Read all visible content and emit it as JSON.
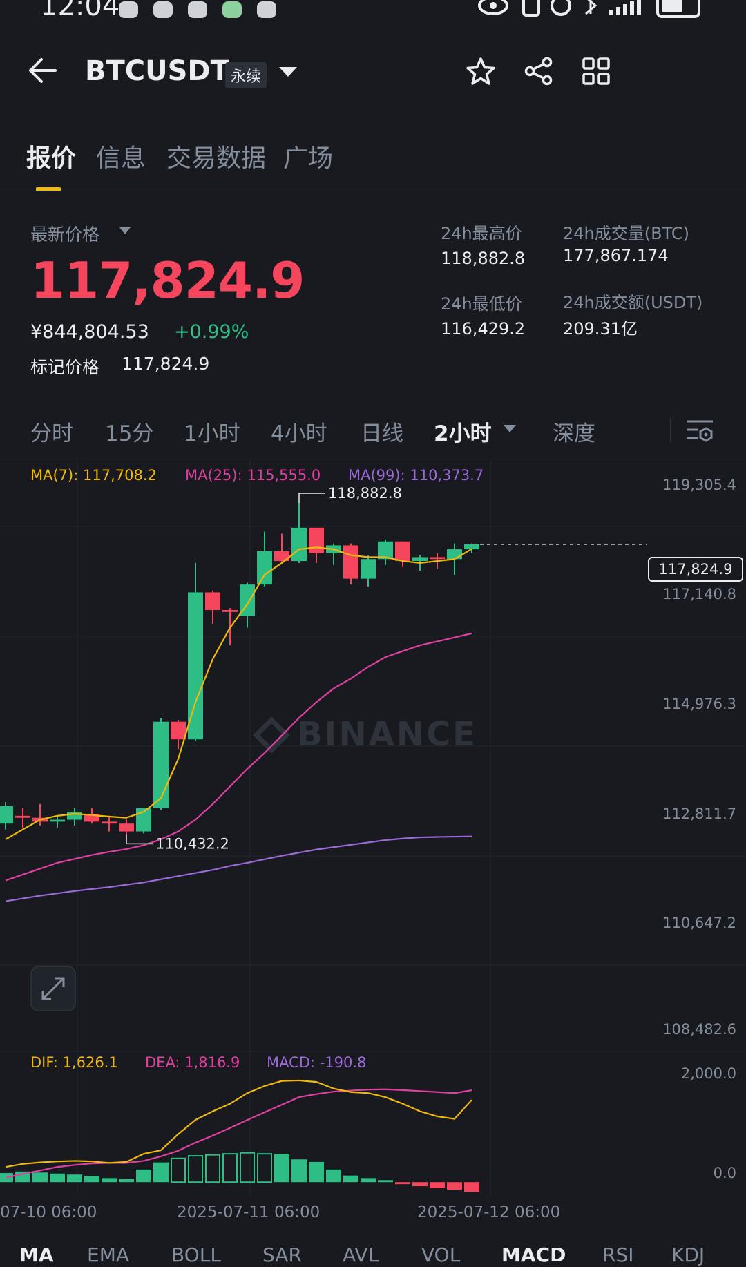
{
  "status_bar": {
    "time": "12:04"
  },
  "header": {
    "symbol": "BTCUSDT",
    "contract_type": "永续"
  },
  "tabs": [
    "报价",
    "信息",
    "交易数据",
    "广场"
  ],
  "price": {
    "label": "最新价格",
    "last": "117,824.9",
    "cny": "¥844,804.53",
    "change": "+0.99%",
    "mark_label": "标记价格",
    "mark": "117,824.9"
  },
  "stats": {
    "high_label": "24h最高价",
    "high": "118,882.8",
    "low_label": "24h最低价",
    "low": "116,429.2",
    "vol_label": "24h成交量(BTC)",
    "vol": "177,867.174",
    "amount_label": "24h成交额(USDT)",
    "amount": "209.31亿"
  },
  "timeframes": [
    "分时",
    "15分",
    "1小时",
    "4小时",
    "日线",
    "2小时",
    "深度"
  ],
  "ma_legend": {
    "ma7": "MA(7): 117,708.2",
    "ma25": "MA(25): 115,555.0",
    "ma99": "MA(99): 110,373.7"
  },
  "price_axis": [
    "119,305.4",
    "117,140.8",
    "114,976.3",
    "112,811.7",
    "110,647.2",
    "108,482.6"
  ],
  "current_price_tag": "117,824.9",
  "watermark": "BINANCE",
  "annotations": {
    "high": "118,882.8",
    "low": "110,432.2"
  },
  "macd_legend": {
    "dif": "DIF: 1,626.1",
    "dea": "DEA: 1,816.9",
    "macd": "MACD: -190.8"
  },
  "macd_axis": [
    "2,000.0",
    "0.0"
  ],
  "x_axis": [
    "07-10 06:00",
    "2025-07-11 06:00",
    "2025-07-12 06:00"
  ],
  "indicator_tabs": [
    "MA",
    "EMA",
    "BOLL",
    "SAR",
    "AVL",
    "VOL",
    "MACD",
    "RSI",
    "KDJ"
  ],
  "colors": {
    "up": "#2ebd85",
    "down": "#f6465d",
    "accent": "#f0b90b",
    "ma7": "#f0b90b",
    "ma25": "#e040a0",
    "ma99": "#9c6ad8"
  },
  "chart_data": {
    "type": "candlestick",
    "interval": "2小时",
    "ylim": [
      108482.6,
      119305.4
    ],
    "candles": [
      {
        "o": 110700,
        "h": 111250,
        "l": 110550,
        "c": 111150
      },
      {
        "o": 110900,
        "h": 111100,
        "l": 110600,
        "c": 110850
      },
      {
        "o": 110850,
        "h": 111200,
        "l": 110650,
        "c": 110750
      },
      {
        "o": 110750,
        "h": 110900,
        "l": 110600,
        "c": 110800
      },
      {
        "o": 110800,
        "h": 111100,
        "l": 110650,
        "c": 111000
      },
      {
        "o": 110950,
        "h": 111100,
        "l": 110700,
        "c": 110750
      },
      {
        "o": 110750,
        "h": 110900,
        "l": 110500,
        "c": 110700
      },
      {
        "o": 110700,
        "h": 110800,
        "l": 110432.2,
        "c": 110500
      },
      {
        "o": 110500,
        "h": 111100,
        "l": 110450,
        "c": 111100
      },
      {
        "o": 111100,
        "h": 113400,
        "l": 111050,
        "c": 113300
      },
      {
        "o": 113300,
        "h": 113350,
        "l": 112600,
        "c": 112850
      },
      {
        "o": 112850,
        "h": 117350,
        "l": 112800,
        "c": 116600
      },
      {
        "o": 116600,
        "h": 116650,
        "l": 115800,
        "c": 116150
      },
      {
        "o": 116150,
        "h": 116200,
        "l": 115250,
        "c": 116100
      },
      {
        "o": 116000,
        "h": 116850,
        "l": 115700,
        "c": 116800
      },
      {
        "o": 116800,
        "h": 118150,
        "l": 116750,
        "c": 117650
      },
      {
        "o": 117650,
        "h": 118100,
        "l": 117350,
        "c": 117400
      },
      {
        "o": 117400,
        "h": 118882.8,
        "l": 117350,
        "c": 118250
      },
      {
        "o": 118250,
        "h": 118250,
        "l": 117350,
        "c": 117600
      },
      {
        "o": 117600,
        "h": 117850,
        "l": 117300,
        "c": 117800
      },
      {
        "o": 117800,
        "h": 117850,
        "l": 116800,
        "c": 116950
      },
      {
        "o": 116950,
        "h": 117550,
        "l": 116750,
        "c": 117450
      },
      {
        "o": 117450,
        "h": 117950,
        "l": 117300,
        "c": 117900
      },
      {
        "o": 117900,
        "h": 117900,
        "l": 117250,
        "c": 117400
      },
      {
        "o": 117400,
        "h": 117550,
        "l": 117150,
        "c": 117500
      },
      {
        "o": 117500,
        "h": 117600,
        "l": 117200,
        "c": 117450
      },
      {
        "o": 117450,
        "h": 117850,
        "l": 117050,
        "c": 117700
      },
      {
        "o": 117700,
        "h": 117850,
        "l": 117600,
        "c": 117824.9
      }
    ],
    "ma7": [
      110300,
      110550,
      110800,
      110900,
      110950,
      110920,
      110880,
      110850,
      111000,
      111350,
      112350,
      113800,
      114900,
      115700,
      116300,
      117050,
      117350,
      117700,
      117750,
      117700,
      117550,
      117500,
      117500,
      117400,
      117350,
      117400,
      117450,
      117708.2
    ],
    "ma25": [
      109250,
      109400,
      109550,
      109700,
      109800,
      109900,
      109980,
      110050,
      110150,
      110300,
      110500,
      110800,
      111200,
      111650,
      112100,
      112500,
      112950,
      113400,
      113800,
      114150,
      114400,
      114700,
      114950,
      115100,
      115250,
      115350,
      115450,
      115555.0
    ],
    "ma99": [
      108720,
      108790,
      108860,
      108920,
      108980,
      109030,
      109080,
      109140,
      109200,
      109280,
      109360,
      109440,
      109520,
      109620,
      109700,
      109790,
      109880,
      109960,
      110040,
      110100,
      110160,
      110220,
      110280,
      110320,
      110350,
      110360,
      110368,
      110373.7
    ],
    "macd": {
      "ylim": [
        -120,
        2200
      ],
      "dif": [
        300,
        360,
        390,
        410,
        420,
        410,
        380,
        400,
        560,
        630,
        950,
        1230,
        1400,
        1550,
        1760,
        1900,
        2000,
        2010,
        1980,
        1850,
        1780,
        1760,
        1680,
        1550,
        1400,
        1300,
        1250,
        1626.1
      ],
      "dea": [
        90,
        160,
        230,
        300,
        340,
        370,
        380,
        380,
        420,
        510,
        620,
        780,
        920,
        1070,
        1230,
        1380,
        1530,
        1680,
        1740,
        1790,
        1810,
        1830,
        1835,
        1820,
        1800,
        1780,
        1760,
        1816.9
      ],
      "hist": [
        180,
        210,
        190,
        170,
        150,
        120,
        80,
        60,
        250,
        390,
        470,
        520,
        540,
        560,
        580,
        560,
        560,
        450,
        400,
        250,
        130,
        80,
        40,
        -40,
        -80,
        -120,
        -150,
        -190.8
      ]
    }
  }
}
